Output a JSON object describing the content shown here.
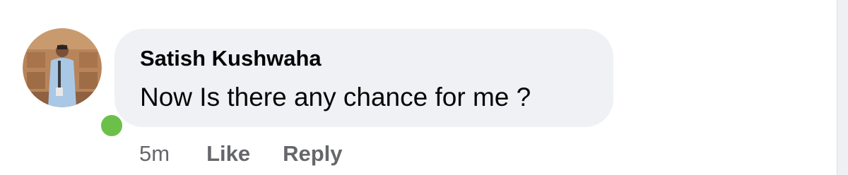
{
  "comment": {
    "author": "Satish Kushwaha",
    "text": "Now Is there any chance for me ?",
    "online": true,
    "avatar_icon": "user-profile-photo"
  },
  "actions": {
    "timestamp": "5m",
    "like_label": "Like",
    "reply_label": "Reply"
  },
  "colors": {
    "bubble_bg": "#f0f1f4",
    "text": "#050505",
    "secondary_text": "#65676b",
    "online_green": "#6cc04a"
  }
}
